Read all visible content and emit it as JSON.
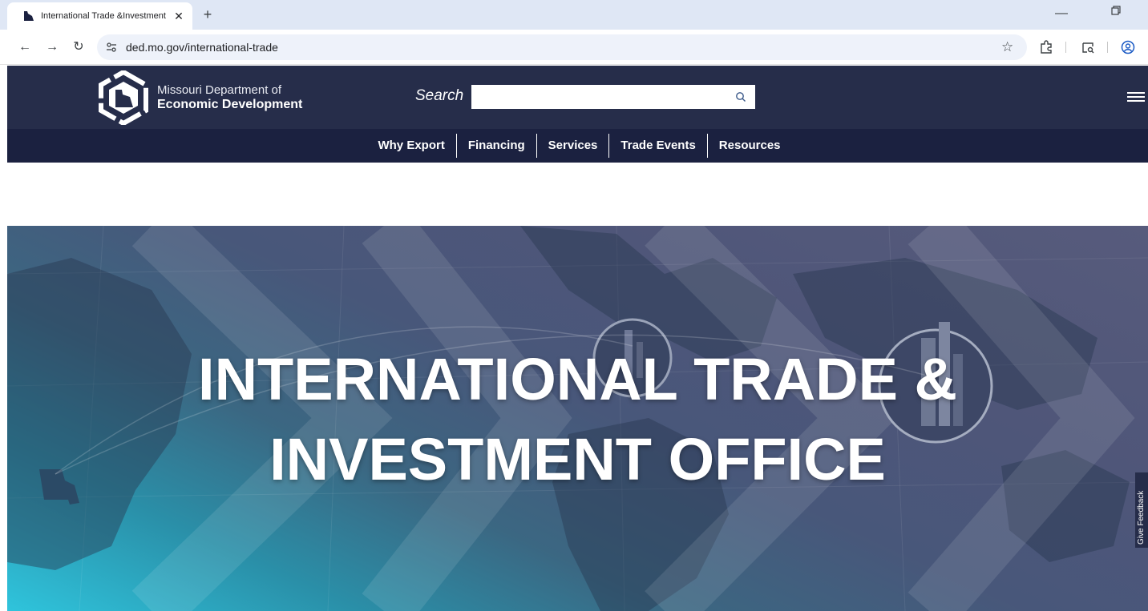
{
  "browser": {
    "tab_title": "International Trade &Investment",
    "new_tab_label": "+",
    "url": "ded.mo.gov/international-trade"
  },
  "header": {
    "org_line1": "Missouri Department of",
    "org_line2": "Economic Development",
    "search_label": "Search",
    "search_value": ""
  },
  "nav": {
    "items": [
      "Why Export",
      "Financing",
      "Services",
      "Trade Events",
      "Resources"
    ]
  },
  "hero": {
    "title_line1": "INTERNATIONAL TRADE &",
    "title_line2": "INVESTMENT OFFICE"
  },
  "feedback": {
    "label": "Give Feedback"
  },
  "colors": {
    "header_bg": "#262d4a",
    "nav_bg": "#1b2140",
    "hero_teal": "#2fc4dc",
    "hero_slate": "#575b7c"
  },
  "icons": [
    "missouri-favicon-icon",
    "close-icon",
    "back-icon",
    "forward-icon",
    "reload-icon",
    "site-info-icon",
    "star-icon",
    "extensions-icon",
    "tab-search-icon",
    "profile-icon",
    "search-icon",
    "hamburger-menu-icon"
  ]
}
